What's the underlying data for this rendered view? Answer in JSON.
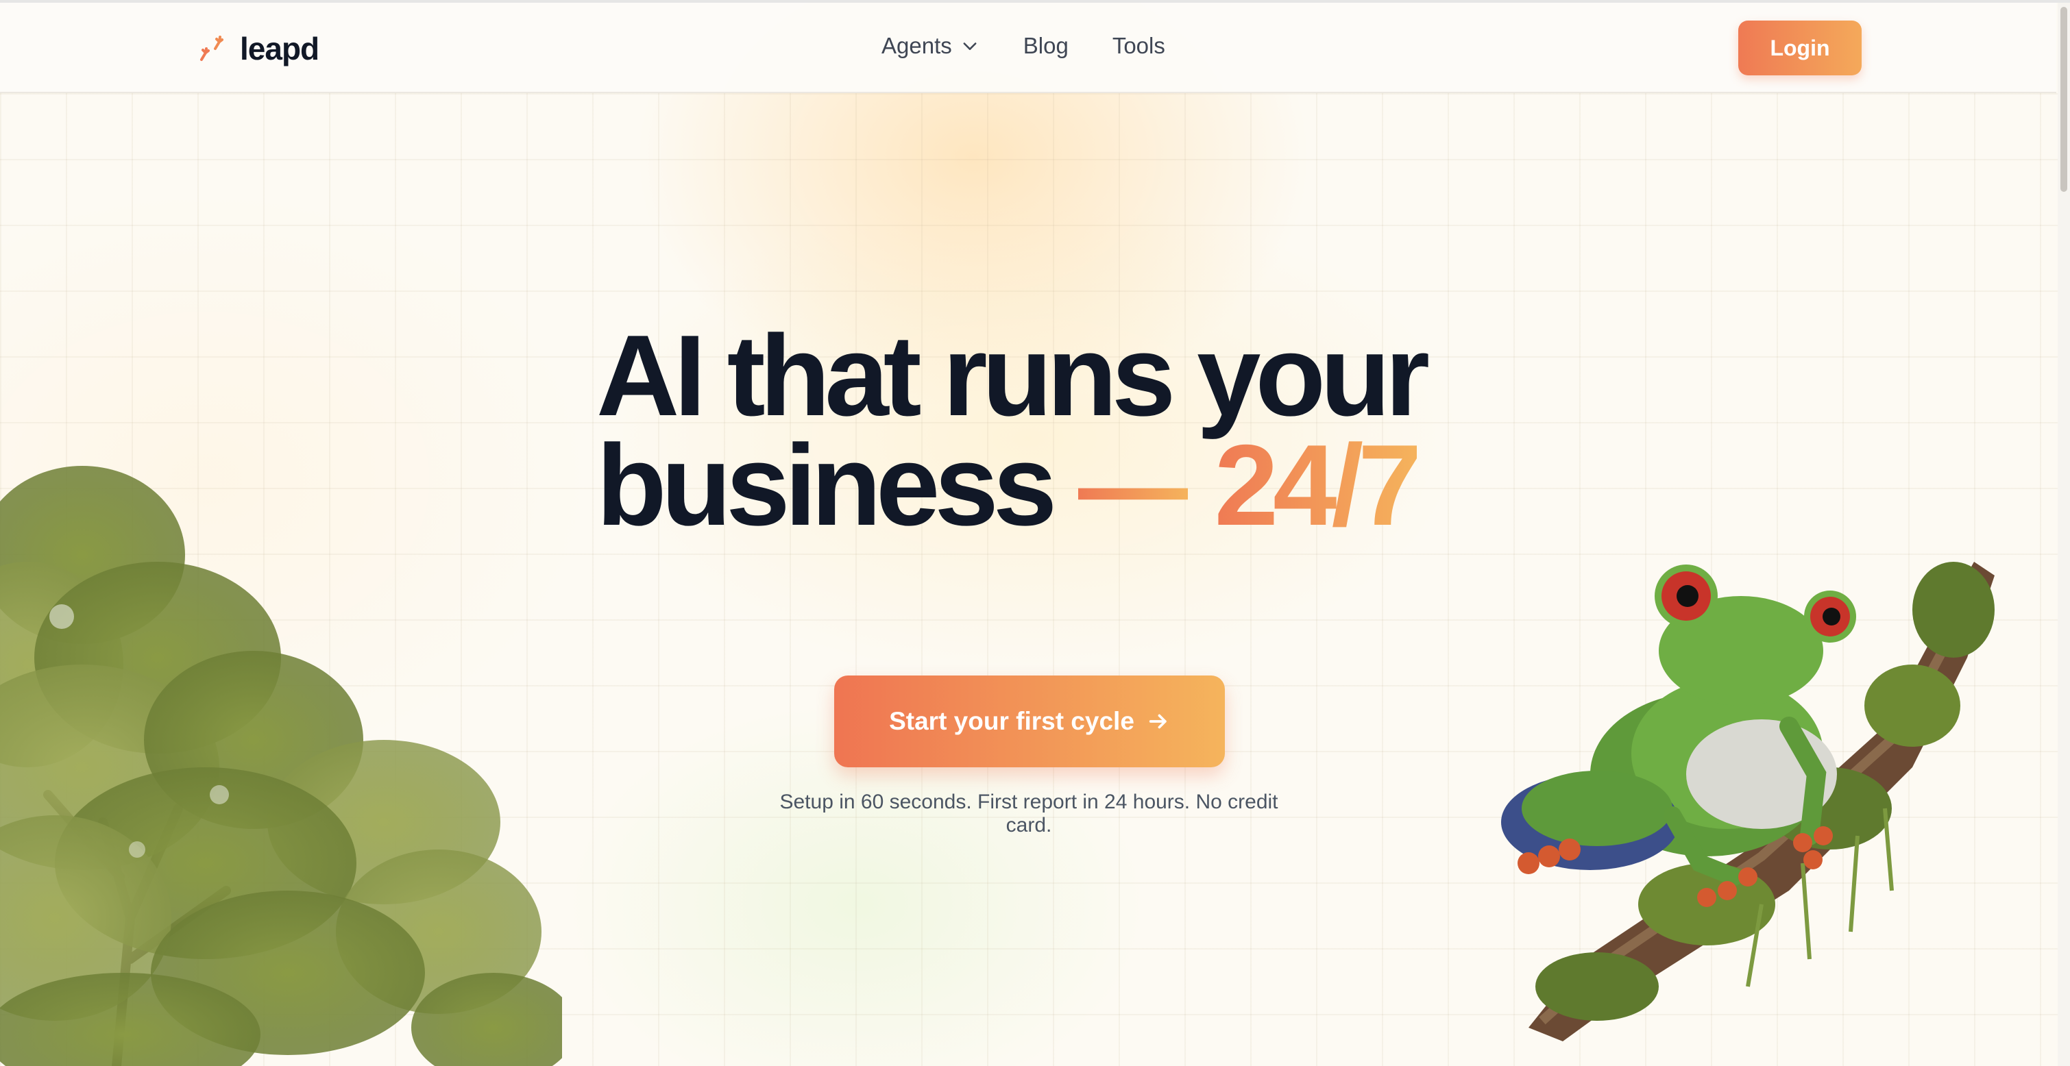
{
  "nav": {
    "brand": "leapd",
    "links": [
      {
        "label": "Agents",
        "has_dropdown": true
      },
      {
        "label": "Blog"
      },
      {
        "label": "Tools"
      }
    ],
    "login_label": "Login"
  },
  "hero": {
    "title_line1": "AI that runs your",
    "title_line2": "business",
    "title_dash": "—",
    "title_accent": "24/7",
    "cta_label": "Start your first cycle",
    "subtext": "Setup in 60 seconds. First report in 24 hours. No credit card."
  },
  "icons": {
    "logo": "frog-footprints-icon",
    "dropdown": "chevron-down-icon",
    "cta": "arrow-right-icon"
  },
  "colors": {
    "accent_start": "#ef7a54",
    "accent_end": "#f5b35c",
    "text_dark": "#111827",
    "background": "#fdfaf3"
  }
}
